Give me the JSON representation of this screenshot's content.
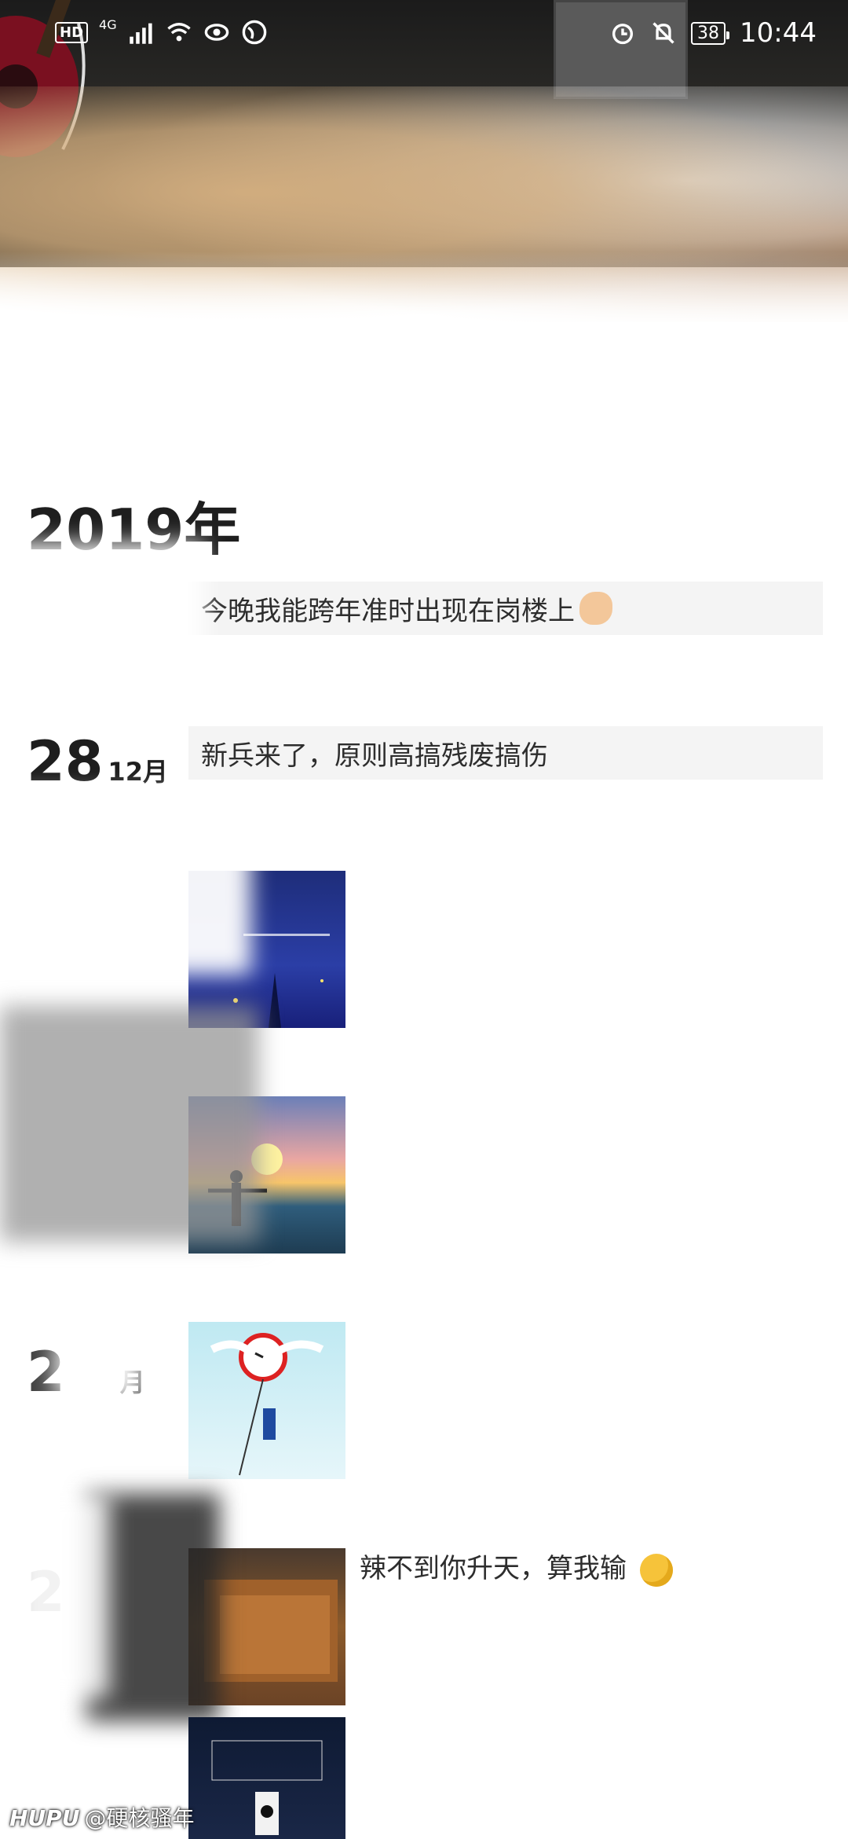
{
  "status_bar": {
    "network_badge": "HD",
    "network_type": "4G",
    "battery": "38",
    "time": "10:44"
  },
  "timeline": {
    "year": "2019年",
    "entries": [
      {
        "text": "今晚我能跨年准时出现在岗楼上",
        "emoji": "flexed-biceps"
      },
      {
        "day": "28",
        "month": "12月",
        "text": "新兵来了，原则高搞残废搞伤"
      },
      {
        "day": "2",
        "month": "月"
      },
      {
        "day": "2",
        "side_text": "辣不到你升天，算我输",
        "emoji": "thinking-face"
      }
    ]
  },
  "watermark": {
    "logo": "HUPU",
    "user": "@硬核骚年"
  }
}
